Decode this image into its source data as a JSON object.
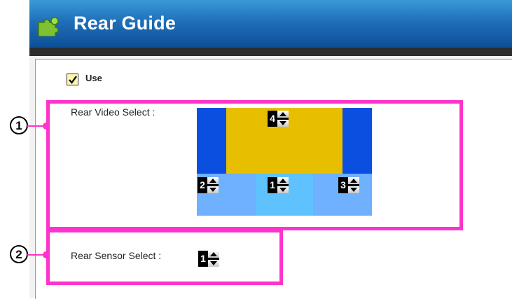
{
  "window": {
    "title": "Rear Guide"
  },
  "use": {
    "label": "Use",
    "checked": true
  },
  "annotations": {
    "marker1": "1",
    "marker2": "2"
  },
  "rear_video": {
    "label": "Rear Video Select :",
    "positions": {
      "top": "4",
      "left": "2",
      "center": "1",
      "right": "3"
    }
  },
  "rear_sensor": {
    "label": "Rear Sensor Select :",
    "value": "1"
  },
  "colors": {
    "title_blue": "#1f6fb8",
    "annotation_pink": "#ff33cc",
    "preview_yellow": "#e8bf00",
    "preview_blue": "#0a4fe0",
    "preview_lightblue": "#6fb0ff"
  }
}
